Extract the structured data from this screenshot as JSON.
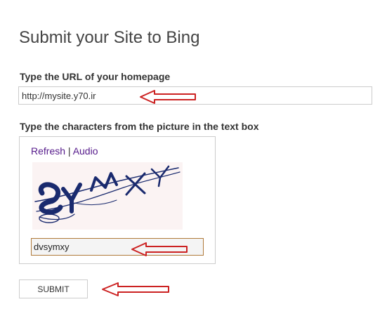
{
  "page": {
    "title": "Submit your Site to Bing"
  },
  "url_field": {
    "label": "Type the URL of your homepage",
    "value": "http://mysite.y70.ir"
  },
  "captcha": {
    "label": "Type the characters from the picture in the text box",
    "refresh_label": "Refresh",
    "separator": " | ",
    "audio_label": "Audio",
    "image_text": "SYMXY",
    "input_value": "dvsymxy"
  },
  "submit": {
    "label": "SUBMIT"
  },
  "colors": {
    "annotation_arrow": "#cc2222",
    "link": "#551a8b",
    "captcha_ink": "#1a2a6e"
  }
}
